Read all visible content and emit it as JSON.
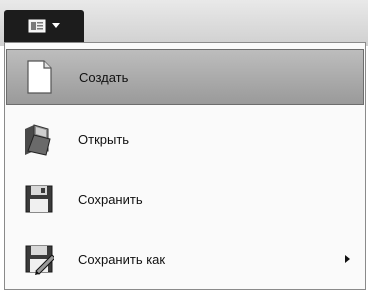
{
  "menu": {
    "items": [
      {
        "label": "Создать",
        "icon": "new-document-icon",
        "highlighted": true,
        "has_submenu": false
      },
      {
        "label": "Открыть",
        "icon": "open-folder-icon",
        "highlighted": false,
        "has_submenu": false
      },
      {
        "label": "Сохранить",
        "icon": "floppy-disk-icon",
        "highlighted": false,
        "has_submenu": false
      },
      {
        "label": "Сохранить как",
        "icon": "save-as-icon",
        "highlighted": false,
        "has_submenu": true
      }
    ]
  },
  "colors": {
    "menu_button": "#1c1c1c",
    "highlight": "#a8a8a8",
    "menu_background": "#fafafa"
  }
}
